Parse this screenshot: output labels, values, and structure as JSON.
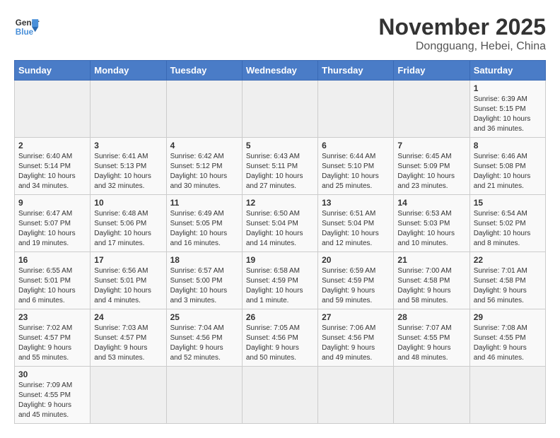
{
  "header": {
    "logo_text_normal": "General",
    "logo_text_colored": "Blue",
    "main_title": "November 2025",
    "subtitle": "Dongguang, Hebei, China"
  },
  "calendar": {
    "days_of_week": [
      "Sunday",
      "Monday",
      "Tuesday",
      "Wednesday",
      "Thursday",
      "Friday",
      "Saturday"
    ],
    "weeks": [
      [
        {
          "day": "",
          "info": ""
        },
        {
          "day": "",
          "info": ""
        },
        {
          "day": "",
          "info": ""
        },
        {
          "day": "",
          "info": ""
        },
        {
          "day": "",
          "info": ""
        },
        {
          "day": "",
          "info": ""
        },
        {
          "day": "1",
          "info": "Sunrise: 6:39 AM\nSunset: 5:15 PM\nDaylight: 10 hours\nand 36 minutes."
        }
      ],
      [
        {
          "day": "2",
          "info": "Sunrise: 6:40 AM\nSunset: 5:14 PM\nDaylight: 10 hours\nand 34 minutes."
        },
        {
          "day": "3",
          "info": "Sunrise: 6:41 AM\nSunset: 5:13 PM\nDaylight: 10 hours\nand 32 minutes."
        },
        {
          "day": "4",
          "info": "Sunrise: 6:42 AM\nSunset: 5:12 PM\nDaylight: 10 hours\nand 30 minutes."
        },
        {
          "day": "5",
          "info": "Sunrise: 6:43 AM\nSunset: 5:11 PM\nDaylight: 10 hours\nand 27 minutes."
        },
        {
          "day": "6",
          "info": "Sunrise: 6:44 AM\nSunset: 5:10 PM\nDaylight: 10 hours\nand 25 minutes."
        },
        {
          "day": "7",
          "info": "Sunrise: 6:45 AM\nSunset: 5:09 PM\nDaylight: 10 hours\nand 23 minutes."
        },
        {
          "day": "8",
          "info": "Sunrise: 6:46 AM\nSunset: 5:08 PM\nDaylight: 10 hours\nand 21 minutes."
        }
      ],
      [
        {
          "day": "9",
          "info": "Sunrise: 6:47 AM\nSunset: 5:07 PM\nDaylight: 10 hours\nand 19 minutes."
        },
        {
          "day": "10",
          "info": "Sunrise: 6:48 AM\nSunset: 5:06 PM\nDaylight: 10 hours\nand 17 minutes."
        },
        {
          "day": "11",
          "info": "Sunrise: 6:49 AM\nSunset: 5:05 PM\nDaylight: 10 hours\nand 16 minutes."
        },
        {
          "day": "12",
          "info": "Sunrise: 6:50 AM\nSunset: 5:04 PM\nDaylight: 10 hours\nand 14 minutes."
        },
        {
          "day": "13",
          "info": "Sunrise: 6:51 AM\nSunset: 5:04 PM\nDaylight: 10 hours\nand 12 minutes."
        },
        {
          "day": "14",
          "info": "Sunrise: 6:53 AM\nSunset: 5:03 PM\nDaylight: 10 hours\nand 10 minutes."
        },
        {
          "day": "15",
          "info": "Sunrise: 6:54 AM\nSunset: 5:02 PM\nDaylight: 10 hours\nand 8 minutes."
        }
      ],
      [
        {
          "day": "16",
          "info": "Sunrise: 6:55 AM\nSunset: 5:01 PM\nDaylight: 10 hours\nand 6 minutes."
        },
        {
          "day": "17",
          "info": "Sunrise: 6:56 AM\nSunset: 5:01 PM\nDaylight: 10 hours\nand 4 minutes."
        },
        {
          "day": "18",
          "info": "Sunrise: 6:57 AM\nSunset: 5:00 PM\nDaylight: 10 hours\nand 3 minutes."
        },
        {
          "day": "19",
          "info": "Sunrise: 6:58 AM\nSunset: 4:59 PM\nDaylight: 10 hours\nand 1 minute."
        },
        {
          "day": "20",
          "info": "Sunrise: 6:59 AM\nSunset: 4:59 PM\nDaylight: 9 hours\nand 59 minutes."
        },
        {
          "day": "21",
          "info": "Sunrise: 7:00 AM\nSunset: 4:58 PM\nDaylight: 9 hours\nand 58 minutes."
        },
        {
          "day": "22",
          "info": "Sunrise: 7:01 AM\nSunset: 4:58 PM\nDaylight: 9 hours\nand 56 minutes."
        }
      ],
      [
        {
          "day": "23",
          "info": "Sunrise: 7:02 AM\nSunset: 4:57 PM\nDaylight: 9 hours\nand 55 minutes."
        },
        {
          "day": "24",
          "info": "Sunrise: 7:03 AM\nSunset: 4:57 PM\nDaylight: 9 hours\nand 53 minutes."
        },
        {
          "day": "25",
          "info": "Sunrise: 7:04 AM\nSunset: 4:56 PM\nDaylight: 9 hours\nand 52 minutes."
        },
        {
          "day": "26",
          "info": "Sunrise: 7:05 AM\nSunset: 4:56 PM\nDaylight: 9 hours\nand 50 minutes."
        },
        {
          "day": "27",
          "info": "Sunrise: 7:06 AM\nSunset: 4:56 PM\nDaylight: 9 hours\nand 49 minutes."
        },
        {
          "day": "28",
          "info": "Sunrise: 7:07 AM\nSunset: 4:55 PM\nDaylight: 9 hours\nand 48 minutes."
        },
        {
          "day": "29",
          "info": "Sunrise: 7:08 AM\nSunset: 4:55 PM\nDaylight: 9 hours\nand 46 minutes."
        }
      ],
      [
        {
          "day": "30",
          "info": "Sunrise: 7:09 AM\nSunset: 4:55 PM\nDaylight: 9 hours\nand 45 minutes."
        },
        {
          "day": "",
          "info": ""
        },
        {
          "day": "",
          "info": ""
        },
        {
          "day": "",
          "info": ""
        },
        {
          "day": "",
          "info": ""
        },
        {
          "day": "",
          "info": ""
        },
        {
          "day": "",
          "info": ""
        }
      ]
    ]
  }
}
